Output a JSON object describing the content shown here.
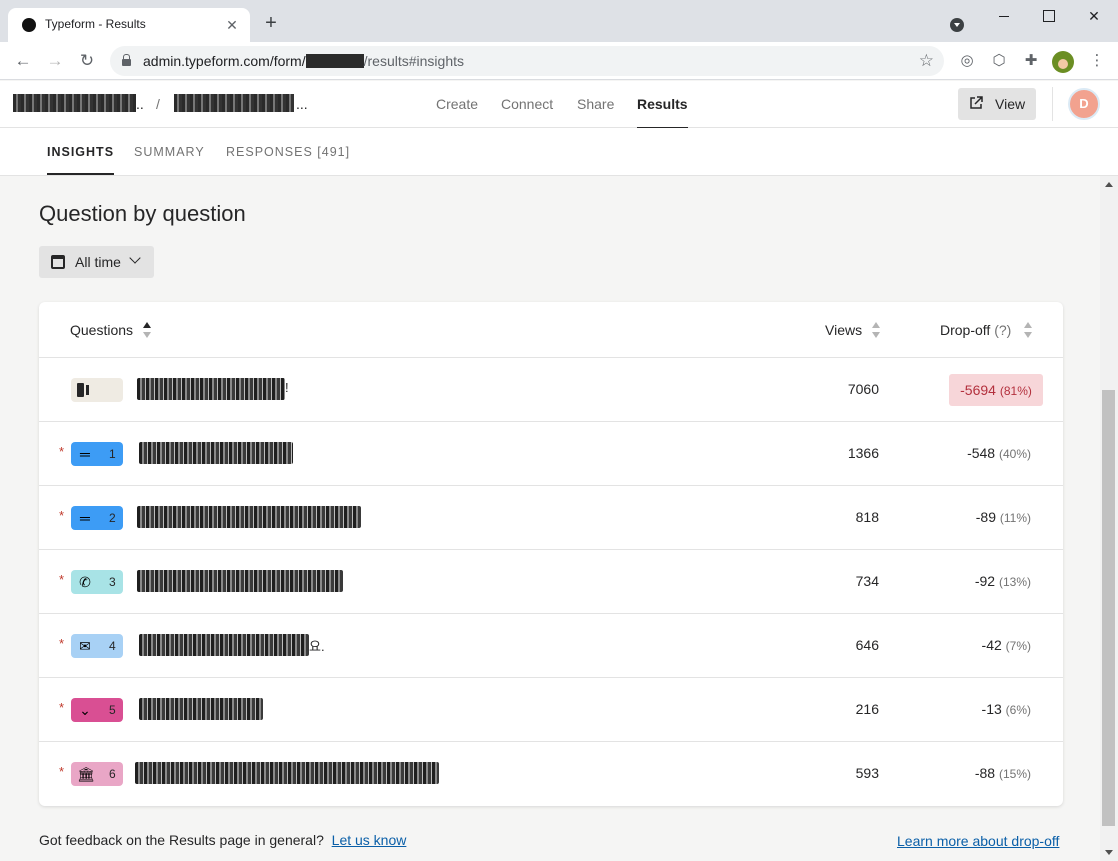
{
  "browser": {
    "tab_title": "Typeform - Results",
    "url_host": "admin.typeform.com/form/",
    "url_rest": "/results#insights"
  },
  "header": {
    "breadcrumb_ellipsis_1": "..",
    "breadcrumb_sep": "/",
    "breadcrumb_ellipsis_2": "...",
    "nav": [
      "Create",
      "Connect",
      "Share",
      "Results"
    ],
    "view_label": "View",
    "user_initial": "D"
  },
  "subtabs": {
    "insights": "INSIGHTS",
    "summary": "SUMMARY",
    "responses": "RESPONSES [491]"
  },
  "main": {
    "title": "Question by question",
    "date_filter": "All time",
    "table": {
      "col_questions": "Questions",
      "col_views": "Views",
      "col_dropoff": "Drop-off",
      "col_dropoff_help": "(?)",
      "rows": [
        {
          "required": "",
          "index": "",
          "type_icon": "welcome-screen-icon",
          "tail": "!",
          "views": "7060",
          "drop": "-5694",
          "pct": "(81%)"
        },
        {
          "required": "*",
          "index": "1",
          "type_icon": "short-text-icon",
          "tail": "",
          "views": "1366",
          "drop": "-548",
          "pct": "(40%)"
        },
        {
          "required": "*",
          "index": "2",
          "type_icon": "short-text-icon",
          "tail": "",
          "views": "818",
          "drop": "-89",
          "pct": "(11%)"
        },
        {
          "required": "*",
          "index": "3",
          "type_icon": "phone-icon",
          "tail": "",
          "views": "734",
          "drop": "-92",
          "pct": "(13%)"
        },
        {
          "required": "*",
          "index": "4",
          "type_icon": "email-icon",
          "tail": "요.",
          "views": "646",
          "drop": "-42",
          "pct": "(7%)"
        },
        {
          "required": "*",
          "index": "5",
          "type_icon": "dropdown-icon",
          "tail": "",
          "views": "216",
          "drop": "-13",
          "pct": "(6%)"
        },
        {
          "required": "*",
          "index": "6",
          "type_icon": "legal-icon",
          "tail": "",
          "views": "593",
          "drop": "-88",
          "pct": "(15%)"
        }
      ]
    }
  },
  "footer": {
    "feedback_text": "Got feedback on the Results page in general?",
    "feedback_link": "Let us know",
    "learn_more": "Learn more about drop-off"
  },
  "colors": {
    "row_badges": [
      "#efebe3",
      "#3d9cf5",
      "#3d9cf5",
      "#a8e3e6",
      "#a8d1f5",
      "#d94f93",
      "#e9a6c6"
    ],
    "dropoff_highlight": "#f7d6d9"
  }
}
